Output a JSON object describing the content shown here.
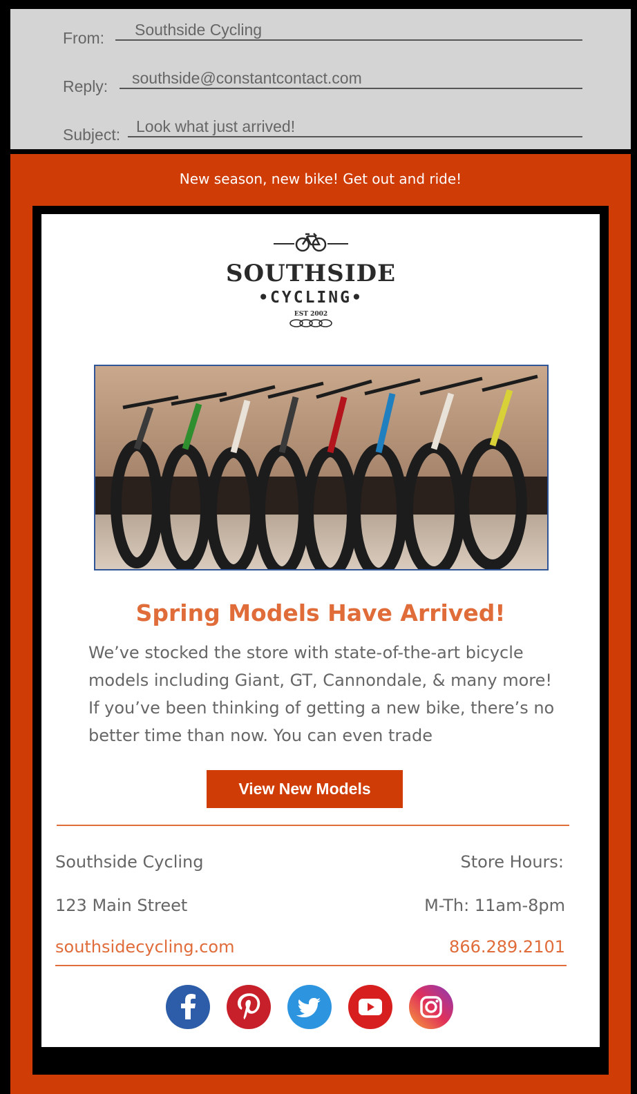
{
  "email_header": {
    "from_label": "From:",
    "from_value": "Southside Cycling",
    "reply_label": "Reply:",
    "reply_value": "southside@constantcontact.com",
    "subject_label": "Subject:",
    "subject_value": "Look what just arrived!"
  },
  "preheader": "New season, new bike! Get out and ride!",
  "logo": {
    "name": "SOUTHSIDE",
    "sub": "•CYCLING•",
    "est": "EST 2002"
  },
  "hero_image": {
    "icon": "bicycles-photo"
  },
  "content": {
    "headline": "Spring Models Have Arrived!",
    "body": "We’ve stocked the store with state-of-the-art bicycle models including Giant, GT, Cannondale, & many more! If you’ve been thinking of getting a new bike, there’s no better time than now. You can even trade",
    "button_label": "View New Models"
  },
  "footer": {
    "business_name": "Southside Cycling",
    "address": "123 Main Street",
    "website": "southsidecycling.com",
    "hours_title": "Store Hours:",
    "hours": "M-Th: 11am-8pm",
    "phone": "866.289.2101"
  },
  "social": [
    {
      "icon": "facebook-icon",
      "color": "#2d5da8"
    },
    {
      "icon": "pinterest-icon",
      "color": "#c8202b"
    },
    {
      "icon": "twitter-icon",
      "color": "#2d95e0"
    },
    {
      "icon": "youtube-icon",
      "color": "#d81f1f"
    },
    {
      "icon": "instagram-icon",
      "color": "#c13584"
    }
  ],
  "colors": {
    "brand_orange": "#d03c06",
    "accent_orange": "#e06c3a",
    "header_gray": "#d4d4d4"
  }
}
